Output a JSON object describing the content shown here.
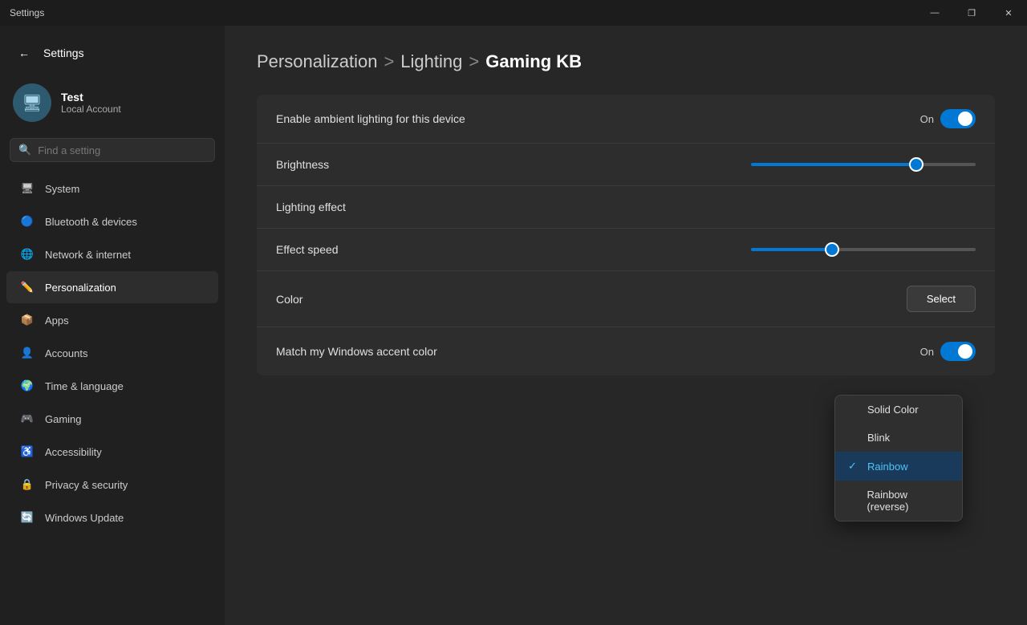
{
  "titlebar": {
    "title": "Settings",
    "minimize": "—",
    "maximize": "❐",
    "close": "✕"
  },
  "sidebar": {
    "back_label": "←",
    "app_title": "Settings",
    "user": {
      "name": "Test",
      "type": "Local Account"
    },
    "search_placeholder": "Find a setting",
    "nav_items": [
      {
        "id": "system",
        "label": "System",
        "icon": "🖥"
      },
      {
        "id": "bluetooth",
        "label": "Bluetooth & devices",
        "icon": "🔵"
      },
      {
        "id": "network",
        "label": "Network & internet",
        "icon": "🌐"
      },
      {
        "id": "personalization",
        "label": "Personalization",
        "icon": "✏️",
        "active": true
      },
      {
        "id": "apps",
        "label": "Apps",
        "icon": "📦"
      },
      {
        "id": "accounts",
        "label": "Accounts",
        "icon": "👤"
      },
      {
        "id": "time",
        "label": "Time & language",
        "icon": "🌍"
      },
      {
        "id": "gaming",
        "label": "Gaming",
        "icon": "🎮"
      },
      {
        "id": "accessibility",
        "label": "Accessibility",
        "icon": "♿"
      },
      {
        "id": "privacy",
        "label": "Privacy & security",
        "icon": "🔒"
      },
      {
        "id": "windows_update",
        "label": "Windows Update",
        "icon": "🔄"
      }
    ]
  },
  "content": {
    "breadcrumb": {
      "part1": "Personalization",
      "sep1": ">",
      "part2": "Lighting",
      "sep2": ">",
      "part3": "Gaming KB"
    },
    "ambient_row": {
      "label": "Enable ambient lighting for this device",
      "toggle_label": "On",
      "toggle_on": true
    },
    "brightness_row": {
      "label": "Brightness"
    },
    "lighting_effect_row": {
      "label": "Lighting effect"
    },
    "effect_speed_row": {
      "label": "Effect speed"
    },
    "color_row": {
      "label": "Color",
      "button_label": "Select"
    },
    "match_color_row": {
      "label": "Match my Windows accent color",
      "toggle_label": "On",
      "toggle_on": true
    },
    "dropdown": {
      "items": [
        {
          "id": "solid",
          "label": "Solid Color",
          "selected": false
        },
        {
          "id": "blink",
          "label": "Blink",
          "selected": false
        },
        {
          "id": "rainbow",
          "label": "Rainbow",
          "selected": true
        },
        {
          "id": "rainbow_rev",
          "label": "Rainbow (reverse)",
          "selected": false
        }
      ]
    }
  }
}
